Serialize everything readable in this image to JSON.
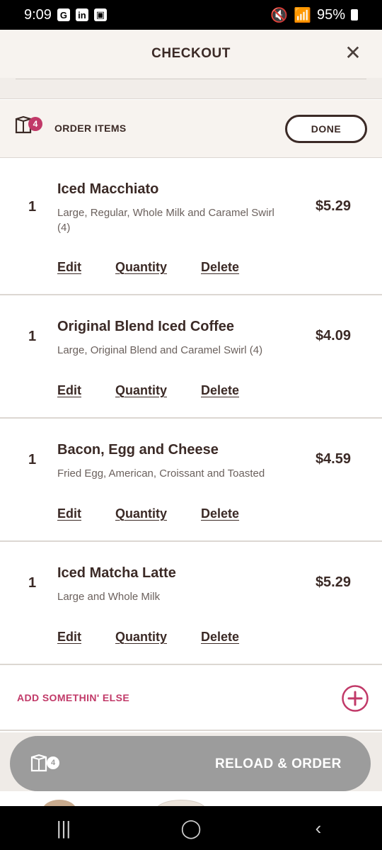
{
  "status": {
    "time": "9:09",
    "left_icons": [
      "G",
      "in",
      "▣"
    ],
    "battery": "95%"
  },
  "header": {
    "title": "CHECKOUT",
    "close_icon": "close-icon"
  },
  "order_bar": {
    "bag_count": "4",
    "label": "ORDER ITEMS",
    "done_label": "DONE"
  },
  "items": [
    {
      "qty": "1",
      "name": "Iced Macchiato",
      "desc": "Large, Regular, Whole Milk and Caramel Swirl (4)",
      "price": "$5.29",
      "edit": "Edit",
      "quantity": "Quantity",
      "delete": "Delete"
    },
    {
      "qty": "1",
      "name": "Original Blend Iced Coffee",
      "desc": "Large, Original Blend and Caramel Swirl (4)",
      "price": "$4.09",
      "edit": "Edit",
      "quantity": "Quantity",
      "delete": "Delete"
    },
    {
      "qty": "1",
      "name": "Bacon, Egg and Cheese",
      "desc": "Fried Egg, American, Croissant and Toasted",
      "price": "$4.59",
      "edit": "Edit",
      "quantity": "Quantity",
      "delete": "Delete"
    },
    {
      "qty": "1",
      "name": "Iced Matcha Latte",
      "desc": "Large and Whole Milk",
      "price": "$5.29",
      "edit": "Edit",
      "quantity": "Quantity",
      "delete": "Delete"
    }
  ],
  "add": {
    "label": "ADD SOMETHIN' ELSE"
  },
  "reload": {
    "bag_count": "4",
    "label": "RELOAD & ORDER"
  },
  "colors": {
    "accent": "#c13968",
    "dark": "#3b2a26",
    "button_disabled": "#9c9c9c"
  }
}
